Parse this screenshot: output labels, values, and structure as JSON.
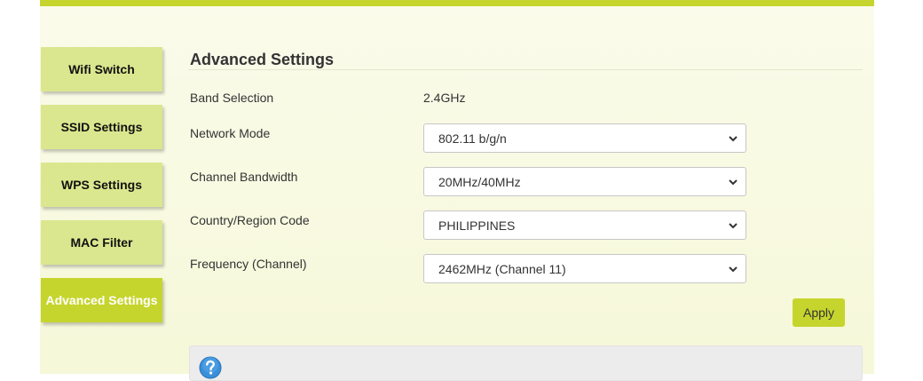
{
  "sidebar": {
    "items": [
      {
        "label": "Wifi Switch",
        "active": false
      },
      {
        "label": "SSID Settings",
        "active": false
      },
      {
        "label": "WPS Settings",
        "active": false
      },
      {
        "label": "MAC Filter",
        "active": false
      },
      {
        "label": "Advanced Settings",
        "active": true
      }
    ]
  },
  "main": {
    "title": "Advanced Settings",
    "band": {
      "label": "Band Selection",
      "value": "2.4GHz"
    },
    "network_mode": {
      "label": "Network Mode",
      "value": "802.11 b/g/n"
    },
    "channel_bandwidth": {
      "label": "Channel Bandwidth",
      "value": "20MHz/40MHz"
    },
    "country_region": {
      "label": "Country/Region Code",
      "value": "PHILIPPINES"
    },
    "frequency": {
      "label": "Frequency (Channel)",
      "value": "2462MHz (Channel 11)"
    },
    "apply_label": "Apply"
  },
  "help": {
    "icon": "question-icon"
  },
  "colors": {
    "accent": "#c6d52d",
    "nav_inactive": "#dbe78e",
    "panel_bg": "#f8f9e2",
    "help_icon": "#3a8fd9"
  }
}
